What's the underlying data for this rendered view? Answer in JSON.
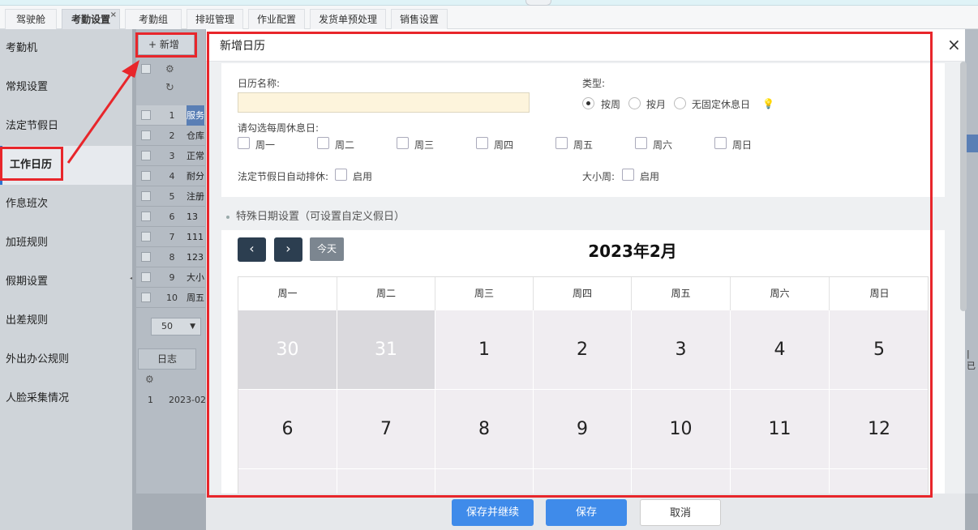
{
  "tabs": [
    {
      "label": "驾驶舱"
    },
    {
      "label": "考勤设置",
      "close": "×"
    },
    {
      "label": "考勤组"
    },
    {
      "label": "排班管理"
    },
    {
      "label": "作业配置"
    },
    {
      "label": "发货单预处理"
    },
    {
      "label": "销售设置"
    }
  ],
  "sidebar": {
    "items": [
      {
        "label": "考勤机"
      },
      {
        "label": "常规设置"
      },
      {
        "label": "法定节假日"
      },
      {
        "label": "工作日历"
      },
      {
        "label": "作息班次"
      },
      {
        "label": "加班规则"
      },
      {
        "label": "假期设置"
      },
      {
        "label": "出差规则"
      },
      {
        "label": "外出办公规则"
      },
      {
        "label": "人脸采集情况"
      }
    ]
  },
  "background": {
    "new_button": "+ 新增",
    "rows": [
      {
        "n": "1",
        "text": "服务"
      },
      {
        "n": "2",
        "text": "仓库"
      },
      {
        "n": "3",
        "text": "正常"
      },
      {
        "n": "4",
        "text": "耐分"
      },
      {
        "n": "5",
        "text": "注册"
      },
      {
        "n": "6",
        "text": "13"
      },
      {
        "n": "7",
        "text": "111"
      },
      {
        "n": "8",
        "text": "123"
      },
      {
        "n": "9",
        "text": "大小"
      },
      {
        "n": "10",
        "text": "周五"
      }
    ],
    "page_size": "50",
    "log_tab": "日志",
    "log_row": {
      "n": "1",
      "text": "2023-02"
    },
    "right_text": "| 已"
  },
  "modal": {
    "title": "新增日历",
    "close": "×",
    "name_label": "日历名称:",
    "name_value": "",
    "type_label": "类型:",
    "type_options": [
      "按周",
      "按月",
      "无固定休息日"
    ],
    "type_selected": "按周",
    "weekly_label": "请勾选每周休息日:",
    "weekdays": [
      "周一",
      "周二",
      "周三",
      "周四",
      "周五",
      "周六",
      "周日"
    ],
    "holiday_label": "法定节假日自动排休:",
    "holiday_enable": "启用",
    "bigsmall_label": "大小周:",
    "bigsmall_enable": "启用",
    "special_title": "特殊日期设置（可设置自定义假日）",
    "calendar": {
      "prev": "‹",
      "next": "›",
      "today": "今天",
      "title": "2023年2月",
      "headers": [
        "周一",
        "周二",
        "周三",
        "周四",
        "周五",
        "周六",
        "周日"
      ],
      "week1": [
        "30",
        "31",
        "1",
        "2",
        "3",
        "4",
        "5"
      ],
      "week2": [
        "6",
        "7",
        "8",
        "9",
        "10",
        "11",
        "12"
      ]
    }
  },
  "footer": {
    "save_continue": "保存并继续",
    "save": "保存",
    "cancel": "取消"
  },
  "colors": {
    "primary": "#3f8bea",
    "highlight": "#e8262b",
    "nav_dark": "#2c3e50"
  }
}
